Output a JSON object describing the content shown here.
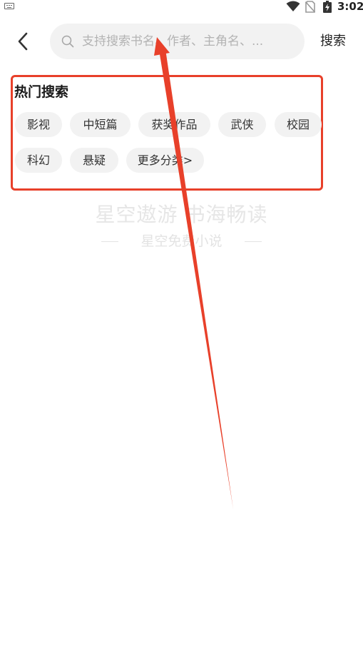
{
  "status_bar": {
    "time": "3:02",
    "icons": [
      "keyboard-icon",
      "wifi-icon",
      "no-sim-icon",
      "battery-charging-icon"
    ]
  },
  "header": {
    "back_icon": "chevron-left-icon",
    "search": {
      "placeholder": "支持搜索书名、作者、主角名、...",
      "value": "",
      "icon": "search-icon"
    },
    "search_button_label": "搜索"
  },
  "hot_search": {
    "title": "热门搜索",
    "tags": [
      {
        "label": "影视"
      },
      {
        "label": "中短篇"
      },
      {
        "label": "获奖作品"
      },
      {
        "label": "武侠"
      },
      {
        "label": "校园"
      },
      {
        "label": "科幻"
      },
      {
        "label": "悬疑"
      },
      {
        "label": "更多分类>"
      }
    ]
  },
  "watermark": {
    "main": "星空遨游 书海畅读",
    "sub": "星空免费小说"
  },
  "colors": {
    "accent_highlight": "#e8402a",
    "tag_background": "#f2f2f2",
    "search_background": "#f2f2f2",
    "placeholder_text": "#b3b3b3"
  }
}
